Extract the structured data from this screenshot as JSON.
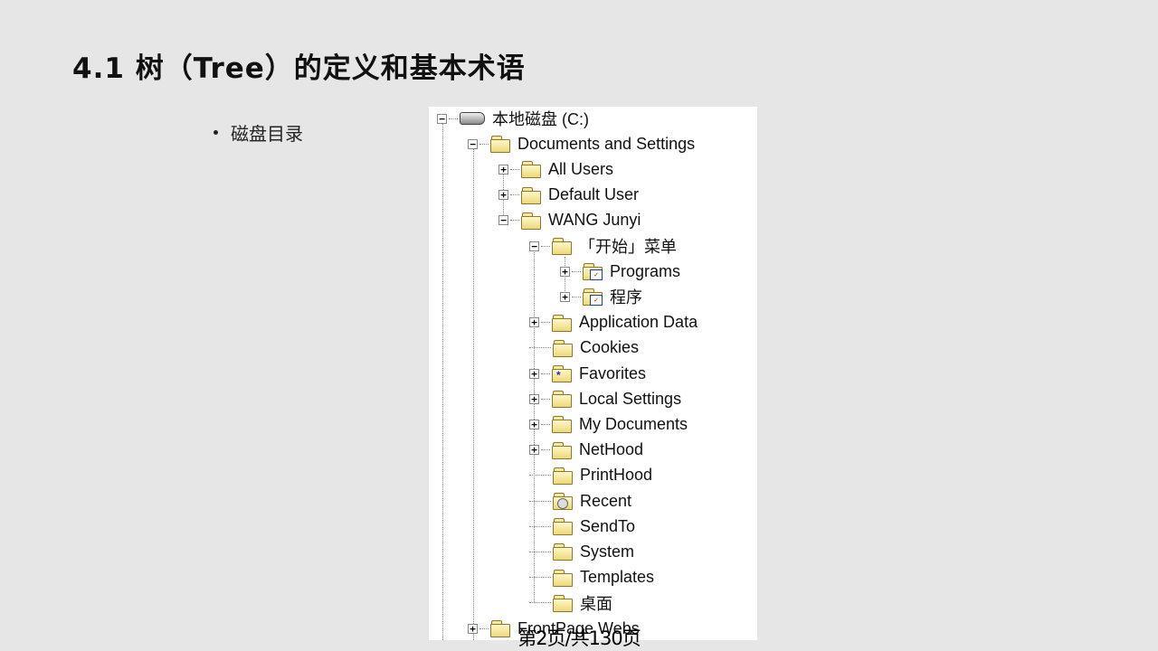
{
  "slide": {
    "title": "4.1  树（Tree）的定义和基本术语",
    "bullet": "磁盘目录",
    "footer": "第2页/共130页"
  },
  "tree": {
    "items": [
      {
        "label": "本地磁盘 (C:)",
        "depth": 0,
        "toggle": "−",
        "icon": "drive-icon"
      },
      {
        "label": "Documents and Settings",
        "depth": 1,
        "toggle": "−",
        "icon": "folder-icon"
      },
      {
        "label": "All Users",
        "depth": 2,
        "toggle": "+",
        "icon": "folder-icon"
      },
      {
        "label": "Default User",
        "depth": 2,
        "toggle": "+",
        "icon": "folder-icon"
      },
      {
        "label": "WANG Junyi",
        "depth": 2,
        "toggle": "−",
        "icon": "folder-icon"
      },
      {
        "label": "「开始」菜单",
        "depth": 3,
        "toggle": "−",
        "icon": "folder-icon"
      },
      {
        "label": "Programs",
        "depth": 4,
        "toggle": "+",
        "icon": "program-folder-icon"
      },
      {
        "label": "程序",
        "depth": 4,
        "toggle": "+",
        "icon": "program-folder-icon"
      },
      {
        "label": "Application Data",
        "depth": 3,
        "toggle": "+",
        "icon": "folder-icon"
      },
      {
        "label": "Cookies",
        "depth": 3,
        "toggle": "",
        "icon": "folder-icon"
      },
      {
        "label": "Favorites",
        "depth": 3,
        "toggle": "+",
        "icon": "favorites-folder-icon"
      },
      {
        "label": "Local Settings",
        "depth": 3,
        "toggle": "+",
        "icon": "folder-icon"
      },
      {
        "label": "My Documents",
        "depth": 3,
        "toggle": "+",
        "icon": "folder-icon"
      },
      {
        "label": "NetHood",
        "depth": 3,
        "toggle": "+",
        "icon": "folder-icon"
      },
      {
        "label": "PrintHood",
        "depth": 3,
        "toggle": "",
        "icon": "folder-icon"
      },
      {
        "label": "Recent",
        "depth": 3,
        "toggle": "",
        "icon": "recent-folder-icon"
      },
      {
        "label": "SendTo",
        "depth": 3,
        "toggle": "",
        "icon": "folder-icon"
      },
      {
        "label": "System",
        "depth": 3,
        "toggle": "",
        "icon": "folder-icon"
      },
      {
        "label": "Templates",
        "depth": 3,
        "toggle": "",
        "icon": "folder-icon"
      },
      {
        "label": "桌面",
        "depth": 3,
        "toggle": "",
        "icon": "folder-icon"
      },
      {
        "label": "FrontPage Webs",
        "depth": 1,
        "toggle": "+",
        "icon": "folder-icon"
      }
    ]
  }
}
